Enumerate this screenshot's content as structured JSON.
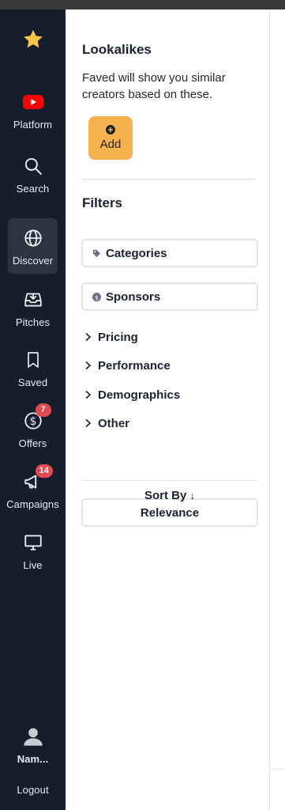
{
  "sidebar": {
    "logo": "star-icon",
    "items": [
      {
        "label": "Platform",
        "icon": "youtube-icon"
      },
      {
        "label": "Search",
        "icon": "search-icon"
      },
      {
        "label": "Discover",
        "icon": "globe-icon",
        "active": true
      },
      {
        "label": "Pitches",
        "icon": "inbox-icon"
      },
      {
        "label": "Saved",
        "icon": "bookmark-icon"
      },
      {
        "label": "Offers",
        "icon": "dollar-icon",
        "badge": "7"
      },
      {
        "label": "Campaigns",
        "icon": "megaphone-icon",
        "badge": "14"
      },
      {
        "label": "Live",
        "icon": "monitor-icon"
      }
    ],
    "user": {
      "name": "Nam...",
      "icon": "user-avatar-icon"
    },
    "logout": "Logout"
  },
  "panel": {
    "lookalikes": {
      "title": "Lookalikes",
      "description": "Faved will show you similar creators based on these.",
      "add_label": "Add"
    },
    "filters": {
      "title": "Filters",
      "chips": [
        {
          "label": "Categories",
          "icon": "tag-icon"
        },
        {
          "label": "Sponsors",
          "icon": "coin-icon"
        }
      ],
      "sections": [
        "Pricing",
        "Performance",
        "Demographics",
        "Other"
      ]
    },
    "sort": {
      "title": "Sort By",
      "arrow": "↓",
      "value": "Relevance"
    }
  },
  "colors": {
    "sidebar_bg": "#161d2c",
    "active_bg": "#2c3444",
    "accent": "#f7b24e",
    "badge": "#e5484d",
    "youtube": "#ff0000"
  }
}
